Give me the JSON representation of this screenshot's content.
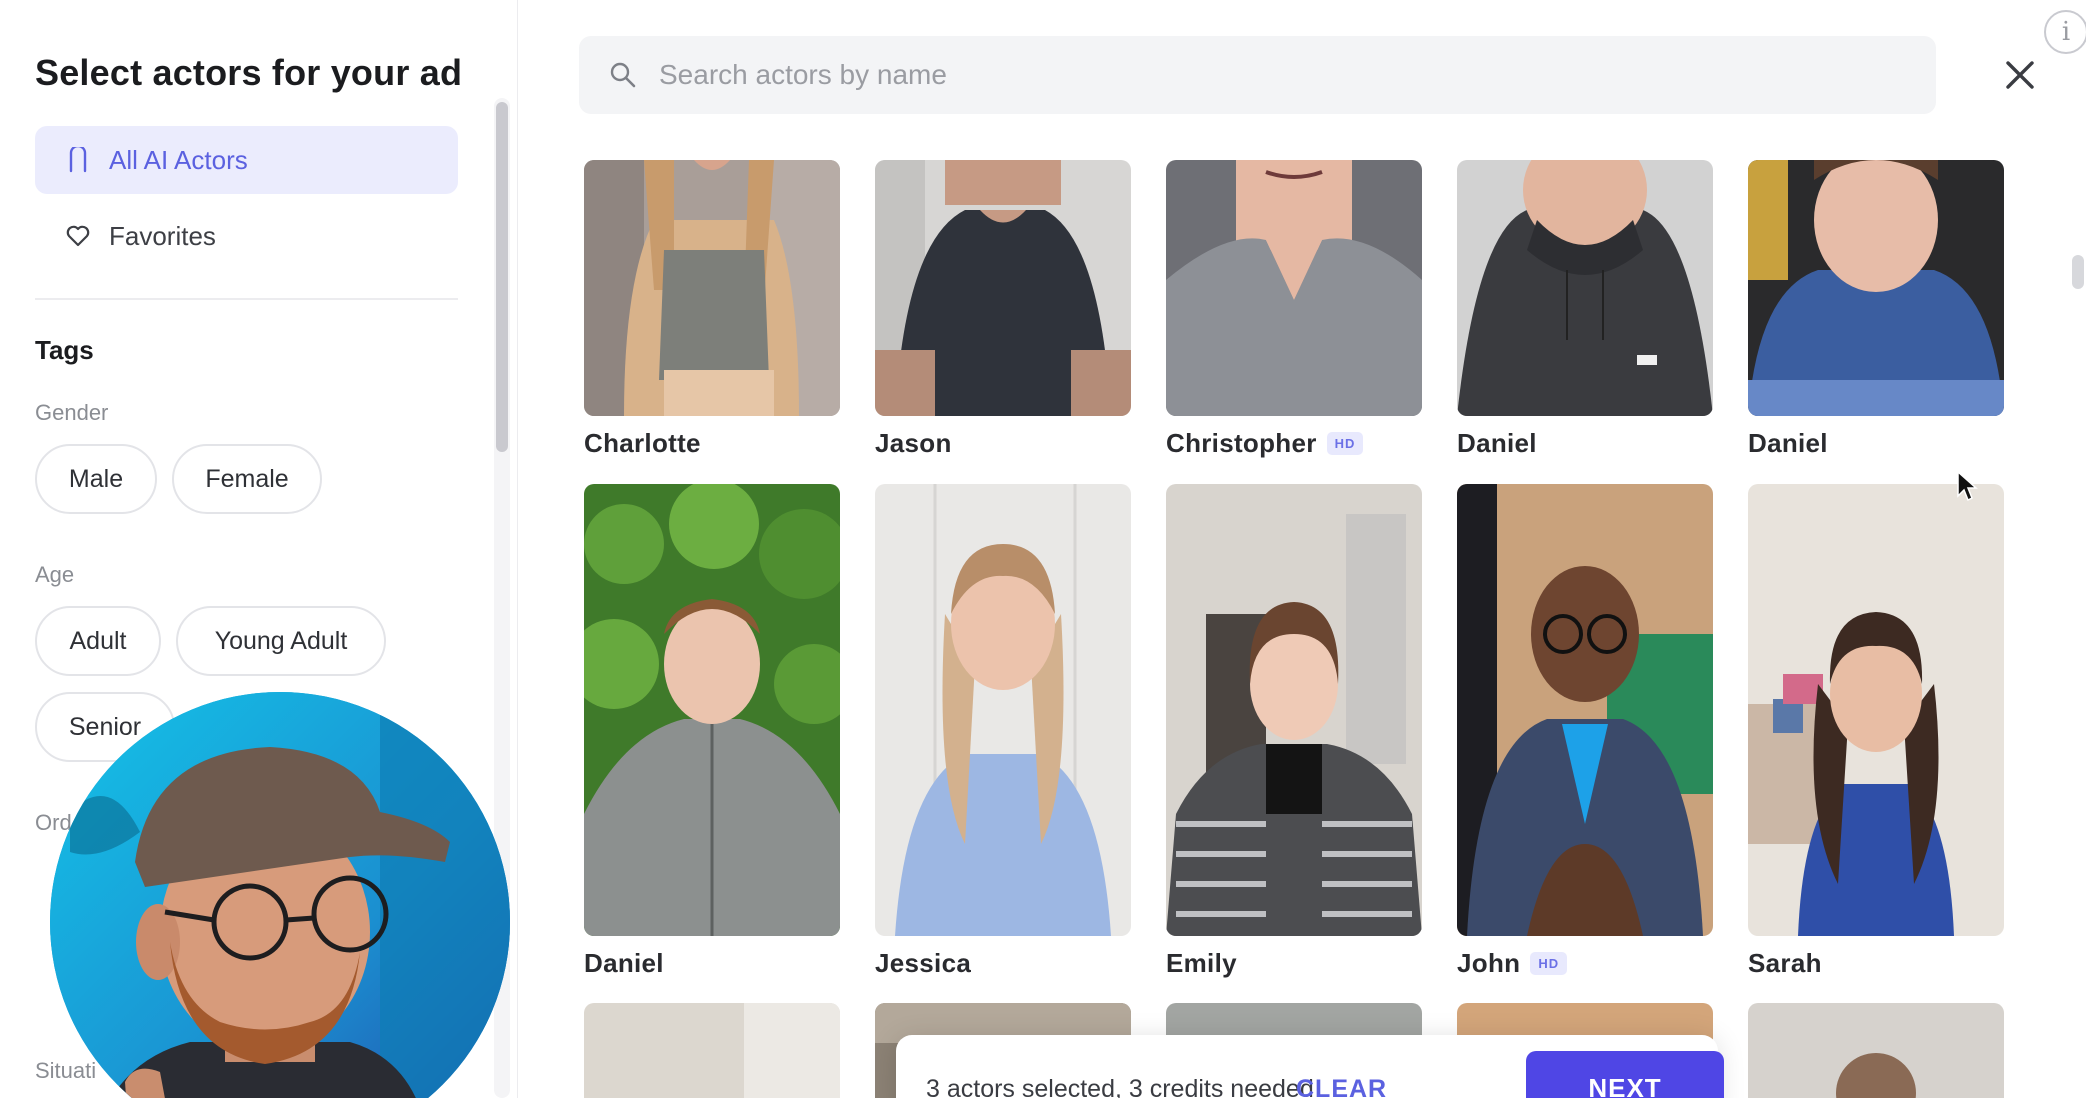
{
  "sidebar": {
    "title": "Select actors for your ad",
    "nav": [
      {
        "label": "All AI Actors",
        "icon": "bookmark-icon",
        "active": true
      },
      {
        "label": "Favorites",
        "icon": "heart-icon",
        "active": false
      }
    ],
    "tags_title": "Tags",
    "gender": {
      "label": "Gender",
      "options": [
        "Male",
        "Female"
      ]
    },
    "age": {
      "label": "Age",
      "options": [
        "Adult",
        "Young Adult",
        "Senior"
      ]
    },
    "order_label_partial": "Ord",
    "situation_label_partial": "Situati"
  },
  "search": {
    "placeholder": "Search actors by name",
    "value": ""
  },
  "actors": [
    {
      "name": "Charlotte",
      "hd": false
    },
    {
      "name": "Jason",
      "hd": false
    },
    {
      "name": "Christopher",
      "hd": true,
      "hd_label": "HD"
    },
    {
      "name": "Daniel",
      "hd": false
    },
    {
      "name": "Daniel",
      "hd": false
    },
    {
      "name": "Daniel",
      "hd": false
    },
    {
      "name": "Jessica",
      "hd": false
    },
    {
      "name": "Emily",
      "hd": false
    },
    {
      "name": "John",
      "hd": true,
      "hd_label": "HD"
    },
    {
      "name": "Sarah",
      "hd": false
    }
  ],
  "selection_bar": {
    "text": "3 actors selected, 3 credits needed",
    "clear_label": "CLEAR",
    "next_label": "NEXT"
  },
  "info_label": "i",
  "colors": {
    "accent": "#5b61e0",
    "next_button": "#4f46e5",
    "active_nav_bg": "#ebecfd"
  }
}
